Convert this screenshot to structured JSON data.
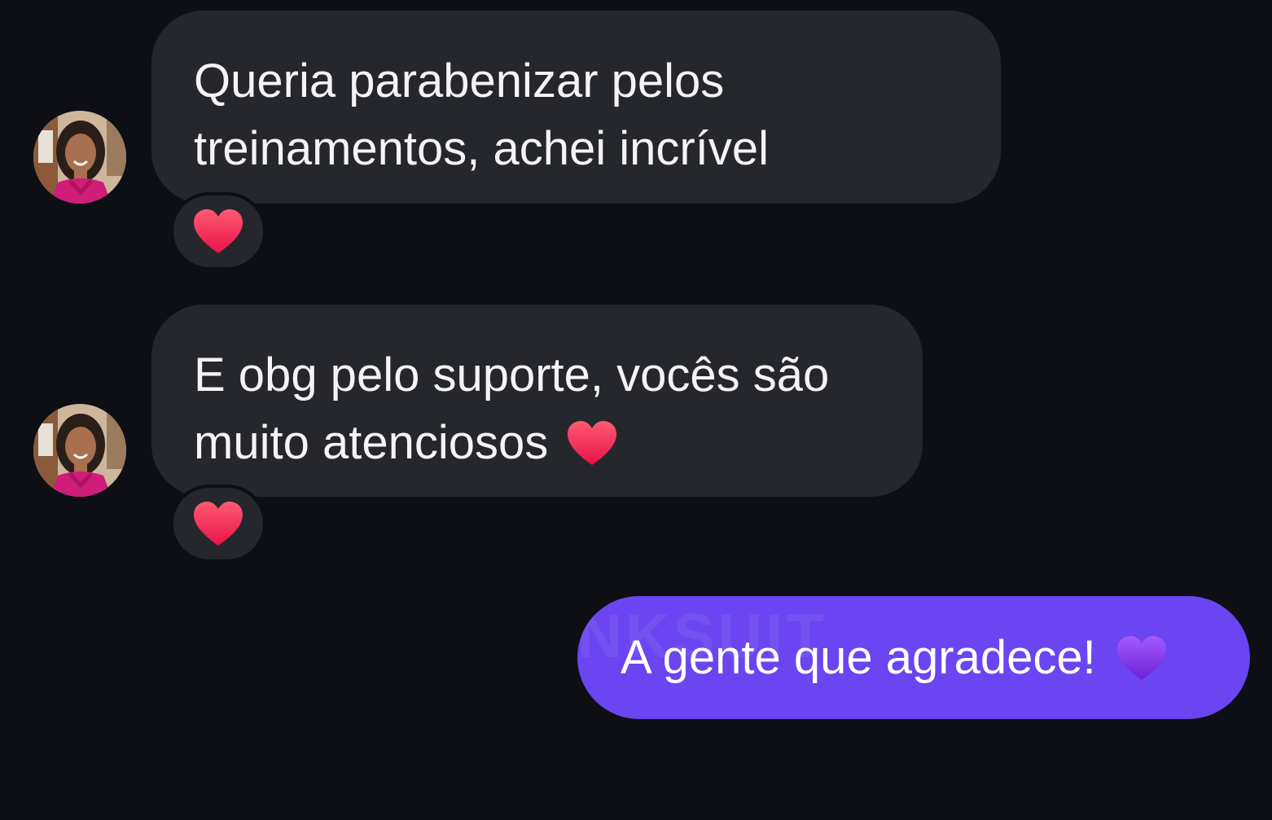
{
  "conversation": {
    "messages": [
      {
        "sender": "contact",
        "lines": [
          "Queria parabenizar pelos",
          "treinamentos, achei incrível"
        ],
        "reaction": "red-heart"
      },
      {
        "sender": "contact",
        "lines": [
          "E obg pelo suporte, vocês são",
          "muito atenciosos"
        ],
        "inline_emoji": "red-heart",
        "reaction": "red-heart"
      },
      {
        "sender": "me",
        "text": "A gente que agradece!",
        "inline_emoji": "purple-heart",
        "watermark": "NKSUIT"
      }
    ]
  },
  "colors": {
    "background": "#0d0f14",
    "incoming_bubble": "#25272c",
    "outgoing_bubble": "#6a45f1",
    "heart_red": "#ff3b5c",
    "heart_purple": "#8b3cf0"
  },
  "icons": {
    "avatar": "contact-avatar-photo",
    "reaction": "red-heart-icon",
    "purple": "purple-heart-icon"
  }
}
